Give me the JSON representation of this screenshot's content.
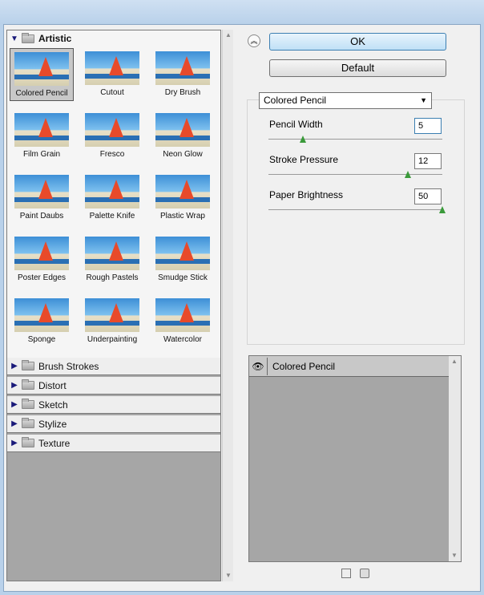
{
  "gallery": {
    "open_category": "Artistic",
    "thumbnails": [
      "Colored Pencil",
      "Cutout",
      "Dry Brush",
      "Film Grain",
      "Fresco",
      "Neon Glow",
      "Paint Daubs",
      "Palette Knife",
      "Plastic Wrap",
      "Poster Edges",
      "Rough Pastels",
      "Smudge Stick",
      "Sponge",
      "Underpainting",
      "Watercolor"
    ],
    "selected": "Colored Pencil",
    "categories": [
      "Brush Strokes",
      "Distort",
      "Sketch",
      "Stylize",
      "Texture"
    ]
  },
  "buttons": {
    "ok": "OK",
    "default": "Default"
  },
  "settings": {
    "filter": "Colored Pencil",
    "params": [
      {
        "label": "Pencil Width",
        "value": "5",
        "level": 0.2
      },
      {
        "label": "Stroke Pressure",
        "value": "12",
        "level": 0.8
      },
      {
        "label": "Paper Brightness",
        "value": "50",
        "level": 1.0
      }
    ]
  },
  "layers": {
    "items": [
      "Colored Pencil"
    ]
  },
  "icons": {
    "collapse": "double-chevron-up-icon",
    "folder": "folder-icon",
    "expand": "triangle-right-icon",
    "collapse_tri": "triangle-down-icon",
    "visibility": "eye-icon",
    "new_layer": "new-layer-icon",
    "delete": "trash-icon"
  },
  "colors": {
    "accent": "#3c7fb1",
    "slider_knob": "#3a9a3a",
    "panel_gray": "#a6a6a6"
  }
}
